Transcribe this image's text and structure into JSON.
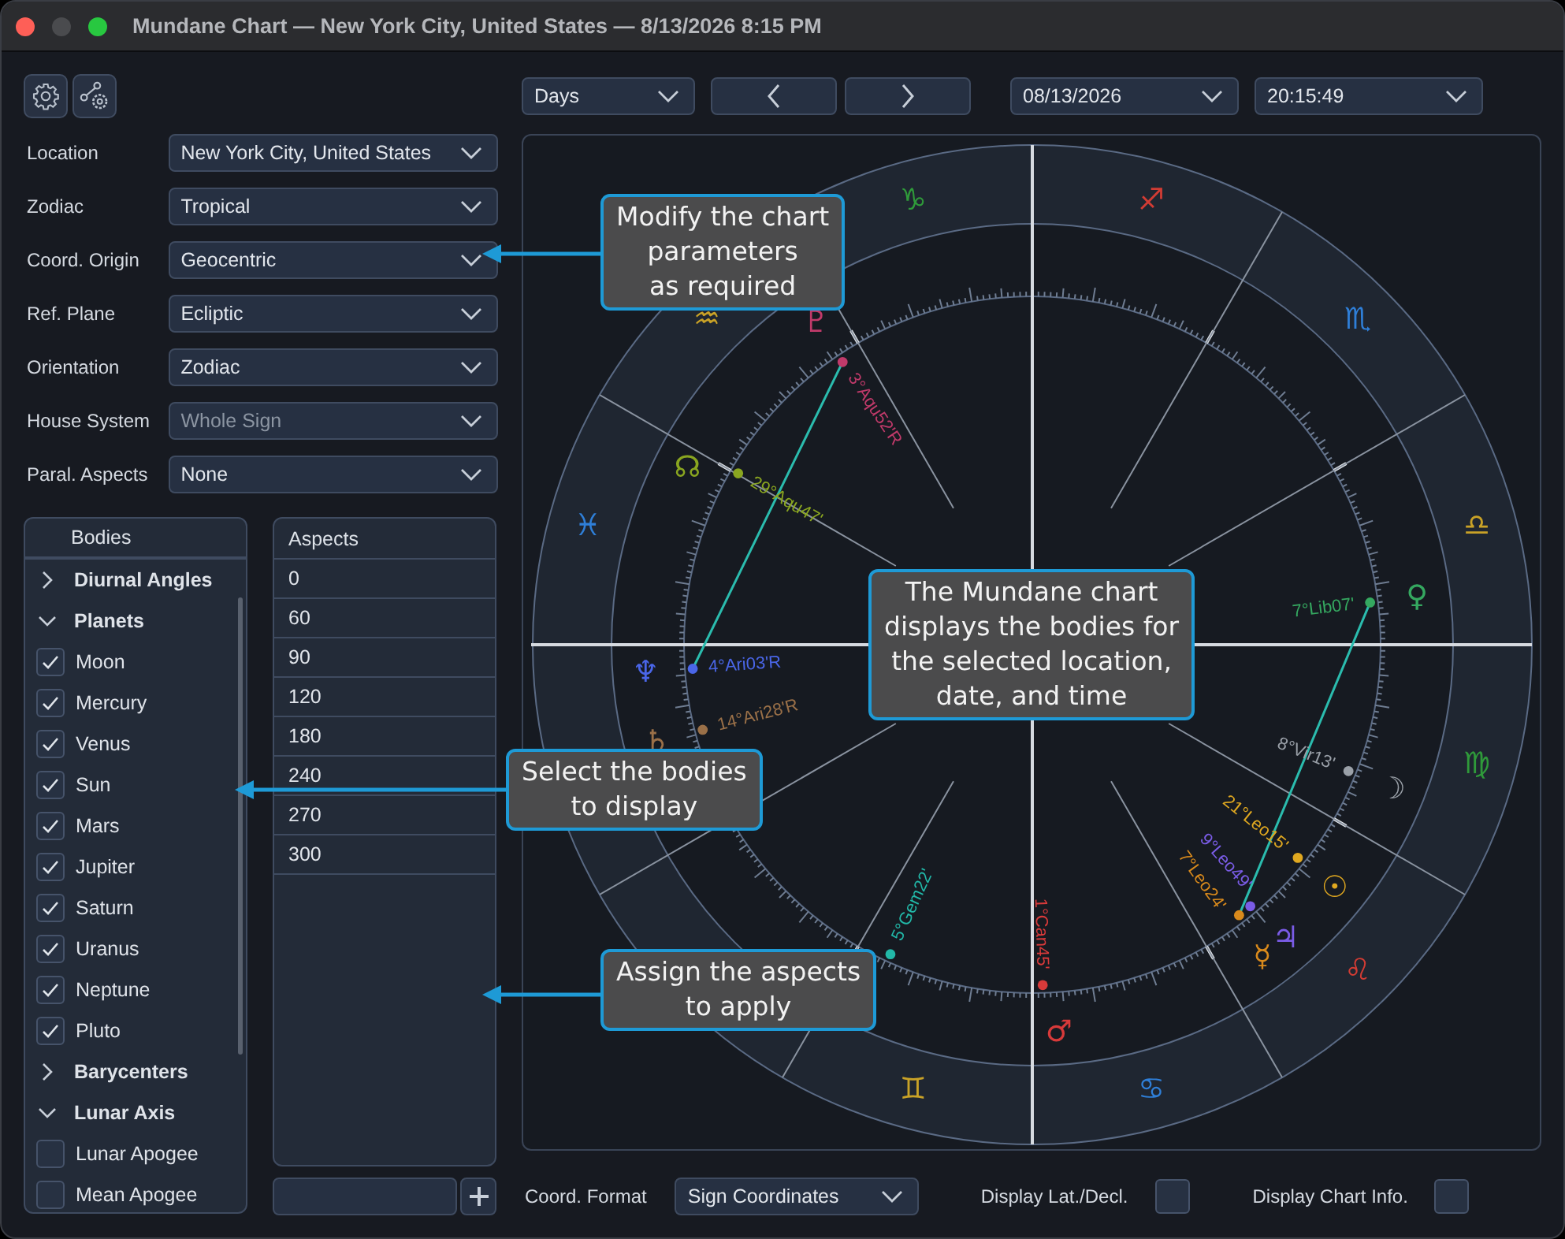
{
  "window": {
    "title": "Mundane Chart — New York City, United States — 8/13/2026 8:15 PM"
  },
  "settings": [
    {
      "label": "Location",
      "value": "New York City, United States",
      "disabled": false
    },
    {
      "label": "Zodiac",
      "value": "Tropical",
      "disabled": false
    },
    {
      "label": "Coord. Origin",
      "value": "Geocentric",
      "disabled": false
    },
    {
      "label": "Ref. Plane",
      "value": "Ecliptic",
      "disabled": false
    },
    {
      "label": "Orientation",
      "value": "Zodiac",
      "disabled": false
    },
    {
      "label": "House System",
      "value": "Whole Sign",
      "disabled": true
    },
    {
      "label": "Paral. Aspects",
      "value": "None",
      "disabled": false
    }
  ],
  "bodies": {
    "header": "Bodies",
    "items": [
      {
        "kind": "group",
        "label": "Diurnal Angles",
        "expanded": false
      },
      {
        "kind": "group",
        "label": "Planets",
        "expanded": true,
        "children": [
          {
            "kind": "body",
            "label": "Moon",
            "checked": true
          },
          {
            "kind": "body",
            "label": "Mercury",
            "checked": true
          },
          {
            "kind": "body",
            "label": "Venus",
            "checked": true
          },
          {
            "kind": "body",
            "label": "Sun",
            "checked": true
          },
          {
            "kind": "body",
            "label": "Mars",
            "checked": true
          },
          {
            "kind": "body",
            "label": "Jupiter",
            "checked": true
          },
          {
            "kind": "body",
            "label": "Saturn",
            "checked": true
          },
          {
            "kind": "body",
            "label": "Uranus",
            "checked": true
          },
          {
            "kind": "body",
            "label": "Neptune",
            "checked": true
          },
          {
            "kind": "body",
            "label": "Pluto",
            "checked": true
          }
        ]
      },
      {
        "kind": "group",
        "label": "Barycenters",
        "expanded": false
      },
      {
        "kind": "group",
        "label": "Lunar Axis",
        "expanded": true,
        "children": [
          {
            "kind": "body",
            "label": "Lunar Apogee",
            "checked": false
          },
          {
            "kind": "body",
            "label": "Mean Apogee",
            "checked": false
          }
        ]
      }
    ]
  },
  "aspects": {
    "header": "Aspects",
    "items": [
      "0",
      "60",
      "90",
      "120",
      "180",
      "240",
      "270",
      "300"
    ]
  },
  "navigation": {
    "period": "Days",
    "date": "08/13/2026",
    "time": "20:15:49"
  },
  "chart": {
    "signs": [
      {
        "glyph": "♊",
        "color": "#c9a227"
      },
      {
        "glyph": "♋",
        "color": "#2f7fd8"
      },
      {
        "glyph": "♌",
        "color": "#d23c34"
      },
      {
        "glyph": "♍",
        "color": "#2f9a3a"
      },
      {
        "glyph": "♎",
        "color": "#c9a227"
      },
      {
        "glyph": "♏",
        "color": "#2f7fd8"
      },
      {
        "glyph": "♐",
        "color": "#d23c34"
      },
      {
        "glyph": "♑",
        "color": "#2f9a3a"
      },
      {
        "glyph": "♒",
        "color": "#c9a227"
      },
      {
        "glyph": "♓",
        "color": "#2f7fd8"
      }
    ],
    "bodies": [
      {
        "glyph": "☽",
        "label": "8°Vir13'",
        "color": "#9aa0a8"
      },
      {
        "glyph": "☿",
        "label": "7°Leo24'",
        "color": "#d98a1c"
      },
      {
        "glyph": "♀",
        "label": "7°Lib07'",
        "color": "#35a860"
      },
      {
        "glyph": "☉",
        "label": "21°Leo15'",
        "color": "#e0a820"
      },
      {
        "glyph": "♂",
        "label": "1°Can45'",
        "color": "#d83a3a"
      },
      {
        "glyph": "♃",
        "label": "9°Leo49'",
        "color": "#7a5ce6"
      },
      {
        "glyph": "♄",
        "label": "14°Ari28'R",
        "color": "#9a7048"
      },
      {
        "label": "5°Gem22'",
        "color": "#22b8a8"
      },
      {
        "glyph": "♆",
        "label": "4°Ari03'R",
        "color": "#4a66e8"
      },
      {
        "glyph": "♇",
        "label": "3°Aqu52'R",
        "color": "#c03a6a"
      },
      {
        "glyph": "☊",
        "label": "29°Aqu47'",
        "color": "#8aa620"
      }
    ]
  },
  "footer": {
    "coord_format_label": "Coord. Format",
    "coord_format": "Sign Coordinates",
    "options": [
      {
        "label": "Display Lat./Decl.",
        "checked": false
      },
      {
        "label": "Display Chart Info.",
        "checked": false
      }
    ]
  },
  "callouts": [
    {
      "text": "Modify the chart\nparameters\nas required"
    },
    {
      "text": "The Mundane chart\ndisplays the bodies for\nthe selected location,\ndate, and time"
    },
    {
      "text": "Select the bodies\nto display"
    },
    {
      "text": "Assign the aspects\nto apply"
    }
  ]
}
